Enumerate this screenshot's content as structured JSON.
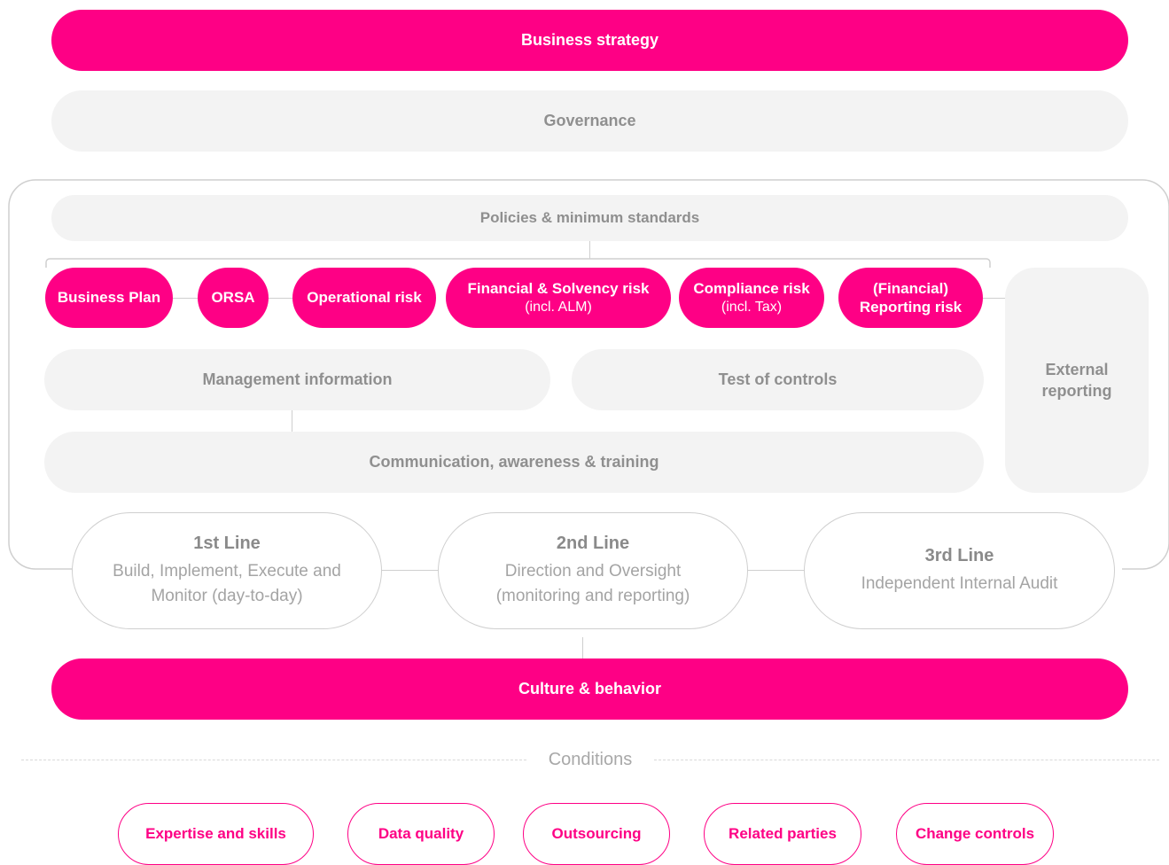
{
  "top": {
    "business_strategy": "Business strategy",
    "governance": "Governance"
  },
  "framework": {
    "policies": "Policies & minimum standards",
    "risks": [
      {
        "title": "Business Plan",
        "sub": ""
      },
      {
        "title": "ORSA",
        "sub": ""
      },
      {
        "title": "Operational risk",
        "sub": ""
      },
      {
        "title": "Financial & Solvency risk",
        "sub": "(incl. ALM)"
      },
      {
        "title": "Compliance risk",
        "sub": "(incl. Tax)"
      },
      {
        "title": "(Financial)",
        "title2": "Reporting risk",
        "sub": ""
      }
    ],
    "management_information": "Management information",
    "test_of_controls": "Test of controls",
    "communication": "Communication, awareness & training",
    "external_reporting_1": "External",
    "external_reporting_2": "reporting"
  },
  "lines": [
    {
      "title": "1st Line",
      "desc1": "Build, Implement, Execute  and",
      "desc2": "Monitor (day-to-day)"
    },
    {
      "title": "2nd Line",
      "desc1": "Direction and Oversight",
      "desc2": "(monitoring and reporting)"
    },
    {
      "title": "3rd Line",
      "desc1": "Independent Internal Audit",
      "desc2": ""
    }
  ],
  "culture": "Culture & behavior",
  "conditions": {
    "label": "Conditions",
    "items": [
      "Expertise and skills",
      "Data quality",
      "Outsourcing",
      "Related parties",
      "Change controls"
    ]
  },
  "colors": {
    "accent": "#fe0085",
    "panel": "#f3f3f3",
    "outline": "#cfcfcf"
  }
}
